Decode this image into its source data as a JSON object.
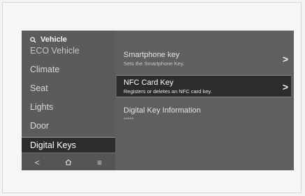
{
  "search": {
    "label": "Vehicle"
  },
  "sidebar": {
    "items": [
      {
        "label": "ECO Vehicle"
      },
      {
        "label": "Climate"
      },
      {
        "label": "Seat"
      },
      {
        "label": "Lights"
      },
      {
        "label": "Door"
      },
      {
        "label": "Digital Keys"
      }
    ],
    "active_index": 5
  },
  "bottom_bar": {
    "back": "<",
    "home": "⌂",
    "menu": "≡"
  },
  "content": {
    "rows": [
      {
        "title": "Smartphone key",
        "subtitle": "Sets the Smartphone Key."
      },
      {
        "title": "NFC Card Key",
        "subtitle": "Registers or deletes an NFC card key."
      },
      {
        "title": "Digital Key Information",
        "subtitle": "*****"
      }
    ],
    "chevron": ">"
  }
}
